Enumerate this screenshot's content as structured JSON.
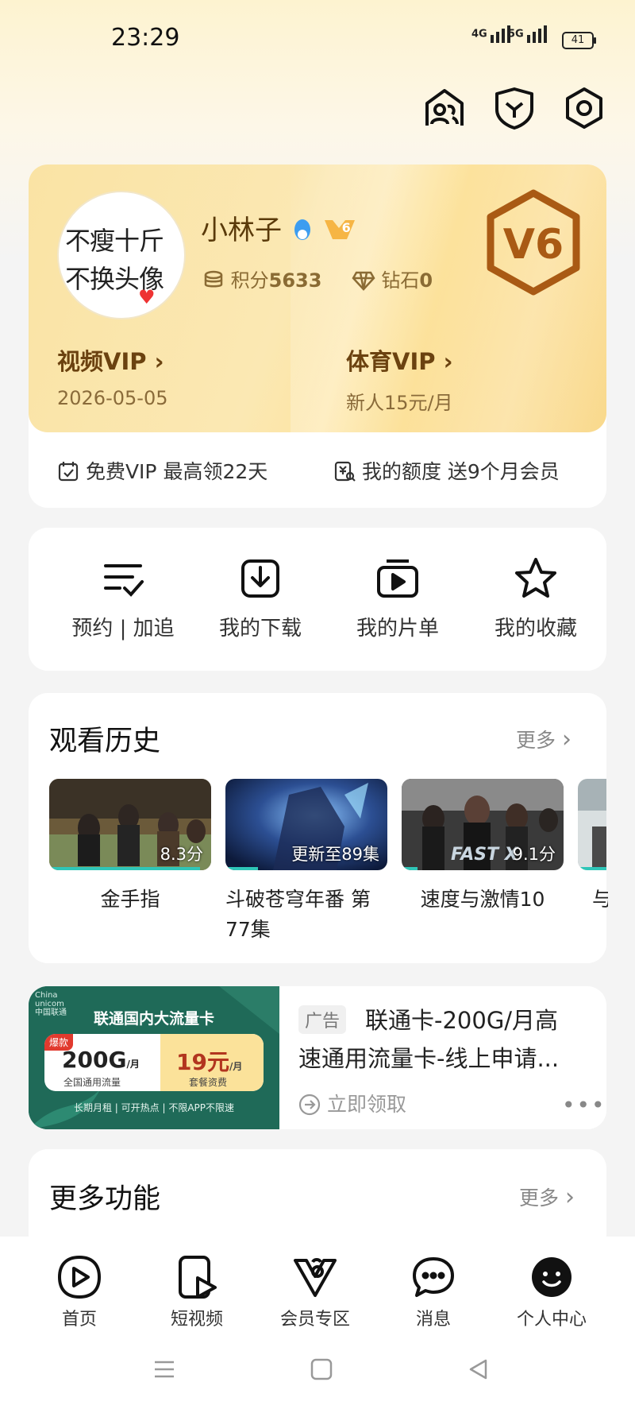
{
  "status_bar": {
    "time": "23:29",
    "signal1": "4G",
    "signal2": "5G",
    "battery": "41"
  },
  "header_icons": [
    "community-icon",
    "shield-icon",
    "settings-icon"
  ],
  "profile": {
    "avatar_line1": "不瘦十斤",
    "avatar_line2": "不换头像",
    "username": "小林子",
    "points_label": "积分",
    "points_value": "5633",
    "diamond_label": "钻石",
    "diamond_value": "0",
    "level_badge": "V6",
    "level_small": "6",
    "video_vip_label": "视频VIP",
    "video_vip_sub": "2026-05-05",
    "sports_vip_label": "体育VIP",
    "sports_vip_sub": "新人15元/月",
    "free_vip": "免费VIP 最高领22天",
    "quota": "我的额度 送9个月会员"
  },
  "quick_actions": [
    {
      "label": "预约 | 加追",
      "icon": "reserve-list-icon"
    },
    {
      "label": "我的下载",
      "icon": "download-icon"
    },
    {
      "label": "我的片单",
      "icon": "playlist-icon"
    },
    {
      "label": "我的收藏",
      "icon": "star-icon"
    }
  ],
  "history": {
    "title": "观看历史",
    "more": "更多",
    "items": [
      {
        "title": "金手指",
        "tag": "8.3分",
        "progress": 0.93
      },
      {
        "title": "斗破苍穹年番 第77集",
        "tag": "更新至89集",
        "progress": 0.2
      },
      {
        "title": "速度与激情10",
        "tag": "9.1分",
        "progress": 0.1
      },
      {
        "title": "与",
        "tag": "",
        "progress": 1.0
      }
    ]
  },
  "ad": {
    "image_title": "联通国内大流量卡",
    "image_tag": "爆款",
    "image_data": "200G",
    "image_data_unit": "/月",
    "image_data_sub": "全国通用流量",
    "image_price": "19元",
    "image_price_unit": "/月",
    "image_price_sub": "套餐资费",
    "image_footer": "长期月租 | 可开热点 | 不限APP不限速",
    "image_brand": "China unicom中国联通",
    "badge": "广告",
    "title": "联通卡-200G/月高速通用流量卡-线上申请...",
    "action": "立即领取"
  },
  "more_functions": {
    "title": "更多功能",
    "more": "更多"
  },
  "bottom_nav": [
    {
      "label": "首页",
      "icon": "home-play-icon"
    },
    {
      "label": "短视频",
      "icon": "short-video-icon"
    },
    {
      "label": "会员专区",
      "icon": "vip-zone-icon"
    },
    {
      "label": "消息",
      "icon": "message-icon"
    },
    {
      "label": "个人中心",
      "icon": "profile-icon"
    }
  ],
  "colors": {
    "accent_gold": "#f9d787",
    "vip_brown": "#6b4210",
    "teal": "#2fc6b8",
    "unicom_green": "#1e6b57"
  }
}
